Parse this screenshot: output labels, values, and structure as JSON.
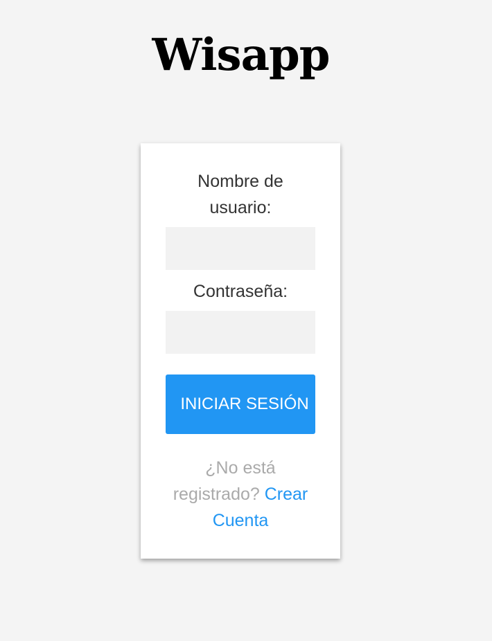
{
  "app": {
    "title": "Wisapp"
  },
  "login_form": {
    "username_label": "Nombre de usuario:",
    "username_value": "",
    "password_label": "Contraseña:",
    "password_value": "",
    "submit_label": "INICIAR SESIÓN",
    "signup_prompt": "¿No está registrado?",
    "signup_link": "Crear Cuenta"
  },
  "colors": {
    "background": "#f4f4f4",
    "card": "#ffffff",
    "input_fill": "#f2f2f2",
    "accent": "#2196f3",
    "muted_text": "#aaaaaa"
  }
}
